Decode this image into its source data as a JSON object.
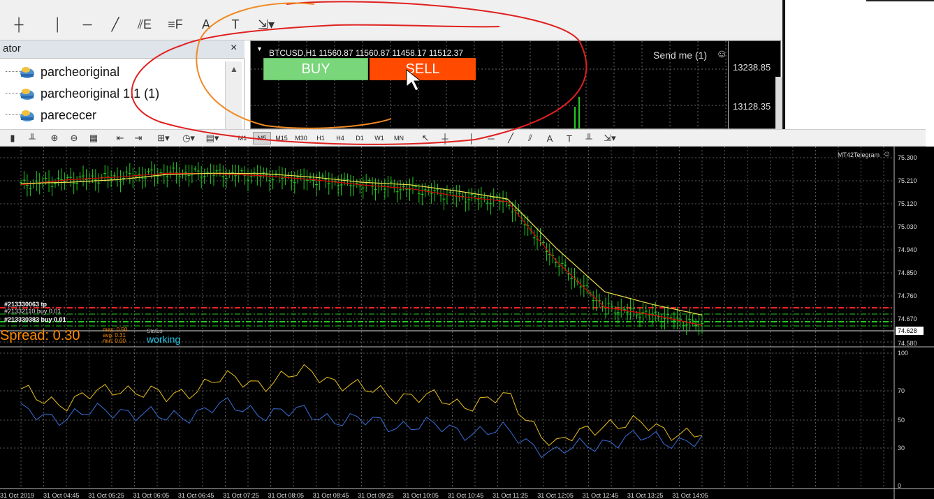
{
  "top_toolbar": {
    "tools": [
      {
        "name": "crosshair-icon",
        "glyph": "┼"
      },
      {
        "name": "vertical-line-icon",
        "glyph": "│"
      },
      {
        "name": "horizontal-line-icon",
        "glyph": "─"
      },
      {
        "name": "trendline-icon",
        "glyph": "╱"
      },
      {
        "name": "fibo-expansion-icon",
        "glyph": "⫽E"
      },
      {
        "name": "fibo-fan-icon",
        "glyph": "≡F"
      },
      {
        "name": "text-icon",
        "glyph": "A"
      },
      {
        "name": "text-label-icon",
        "glyph": "T"
      },
      {
        "name": "arrows-icon",
        "glyph": "⇲▾"
      }
    ]
  },
  "navigator": {
    "title": "ator",
    "close_glyph": "×",
    "items": [
      "parcheoriginal",
      "parcheoriginal 1.1 (1)",
      "parececer"
    ]
  },
  "btc_chart": {
    "header": "BTCUSD,H1  11560.87 11560.87 11458.17 11512.37",
    "buy_label": "BUY",
    "sell_label": "SELL",
    "send_me": "Send me (1)",
    "price_labels": [
      "13238.85",
      "13128.35"
    ],
    "colors": {
      "buy": "#7ad67a",
      "sell": "#ff4a00"
    }
  },
  "main_toolbar": {
    "timeframes": [
      "M1",
      "M5",
      "M15",
      "M30",
      "H1",
      "H4",
      "D1",
      "W1",
      "MN"
    ],
    "selected_timeframe": "M5"
  },
  "main_chart": {
    "watermark": "MT42Telegram",
    "price_axis": [
      "75.300",
      "75.210",
      "75.120",
      "75.030",
      "74.940",
      "74.850",
      "74.760",
      "74.670",
      "74.628",
      "74.580"
    ],
    "current_price": "74.628",
    "spread_label": "Spread: 0.30",
    "spread_stats": [
      {
        "label": "max:",
        "value": "0.50"
      },
      {
        "label": "avg:",
        "value": "0.31"
      },
      {
        "label": "min:",
        "value": "0.00"
      }
    ],
    "status_label": "Status",
    "status_value": "working",
    "order_labels": [
      "#213330063 tp",
      "#21332110 buy 0.01",
      "#213330383 buy 0.01"
    ],
    "colors": {
      "candle": "#22cc22",
      "ma_fast": "#e00000",
      "ma_slow": "#f0e050",
      "ma_mid": "#1a7a1a",
      "tp_line": "#ff2222",
      "order_line": "#22cc22",
      "spread": "#ff8c00",
      "status": "#1ec8e8"
    }
  },
  "oscillator": {
    "scale": [
      "100",
      "70",
      "50",
      "30",
      "0"
    ],
    "colors": {
      "k_line": "#e8c020",
      "d_line": "#3a6fd8"
    }
  },
  "time_axis": [
    "31 Oct 2019",
    "31 Oct 04:45",
    "31 Oct 05:25",
    "31 Oct 06:05",
    "31 Oct 06:45",
    "31 Oct 07:25",
    "31 Oct 08:05",
    "31 Oct 08:45",
    "31 Oct 09:25",
    "31 Oct 10:05",
    "31 Oct 10:45",
    "31 Oct 11:25",
    "31 Oct 12:05",
    "31 Oct 12:45",
    "31 Oct 13:25",
    "31 Oct 14:05"
  ],
  "chart_data": {
    "type": "line",
    "title": "",
    "xlabel": "",
    "ylabel": "",
    "x": [
      "31 Oct 04:45",
      "31 Oct 05:25",
      "31 Oct 06:05",
      "31 Oct 06:45",
      "31 Oct 07:25",
      "31 Oct 08:05",
      "31 Oct 08:45",
      "31 Oct 09:25",
      "31 Oct 10:05",
      "31 Oct 10:45",
      "31 Oct 11:25",
      "31 Oct 12:05",
      "31 Oct 12:45",
      "31 Oct 13:25",
      "31 Oct 14:05"
    ],
    "ylim": [
      74.58,
      75.3
    ],
    "series": [
      {
        "values": [
          75.195,
          75.215,
          75.225,
          75.24,
          75.238,
          75.23,
          75.215,
          75.195,
          75.18,
          75.15,
          75.13,
          74.9,
          74.72,
          74.69,
          74.65
        ]
      },
      {
        "values": [
          75.2,
          75.205,
          75.215,
          75.235,
          75.24,
          75.238,
          75.225,
          75.205,
          75.195,
          75.17,
          75.14,
          74.95,
          74.78,
          74.73,
          74.69
        ]
      }
    ],
    "oscillator": {
      "ylim": [
        0,
        100
      ],
      "series": [
        {
          "values": [
            70,
            62,
            75,
            66,
            80,
            78,
            86,
            72,
            68,
            62,
            66,
            30,
            48,
            44,
            38
          ]
        },
        {
          "values": [
            55,
            52,
            58,
            50,
            60,
            56,
            54,
            48,
            46,
            42,
            40,
            24,
            34,
            36,
            33
          ]
        }
      ]
    }
  }
}
